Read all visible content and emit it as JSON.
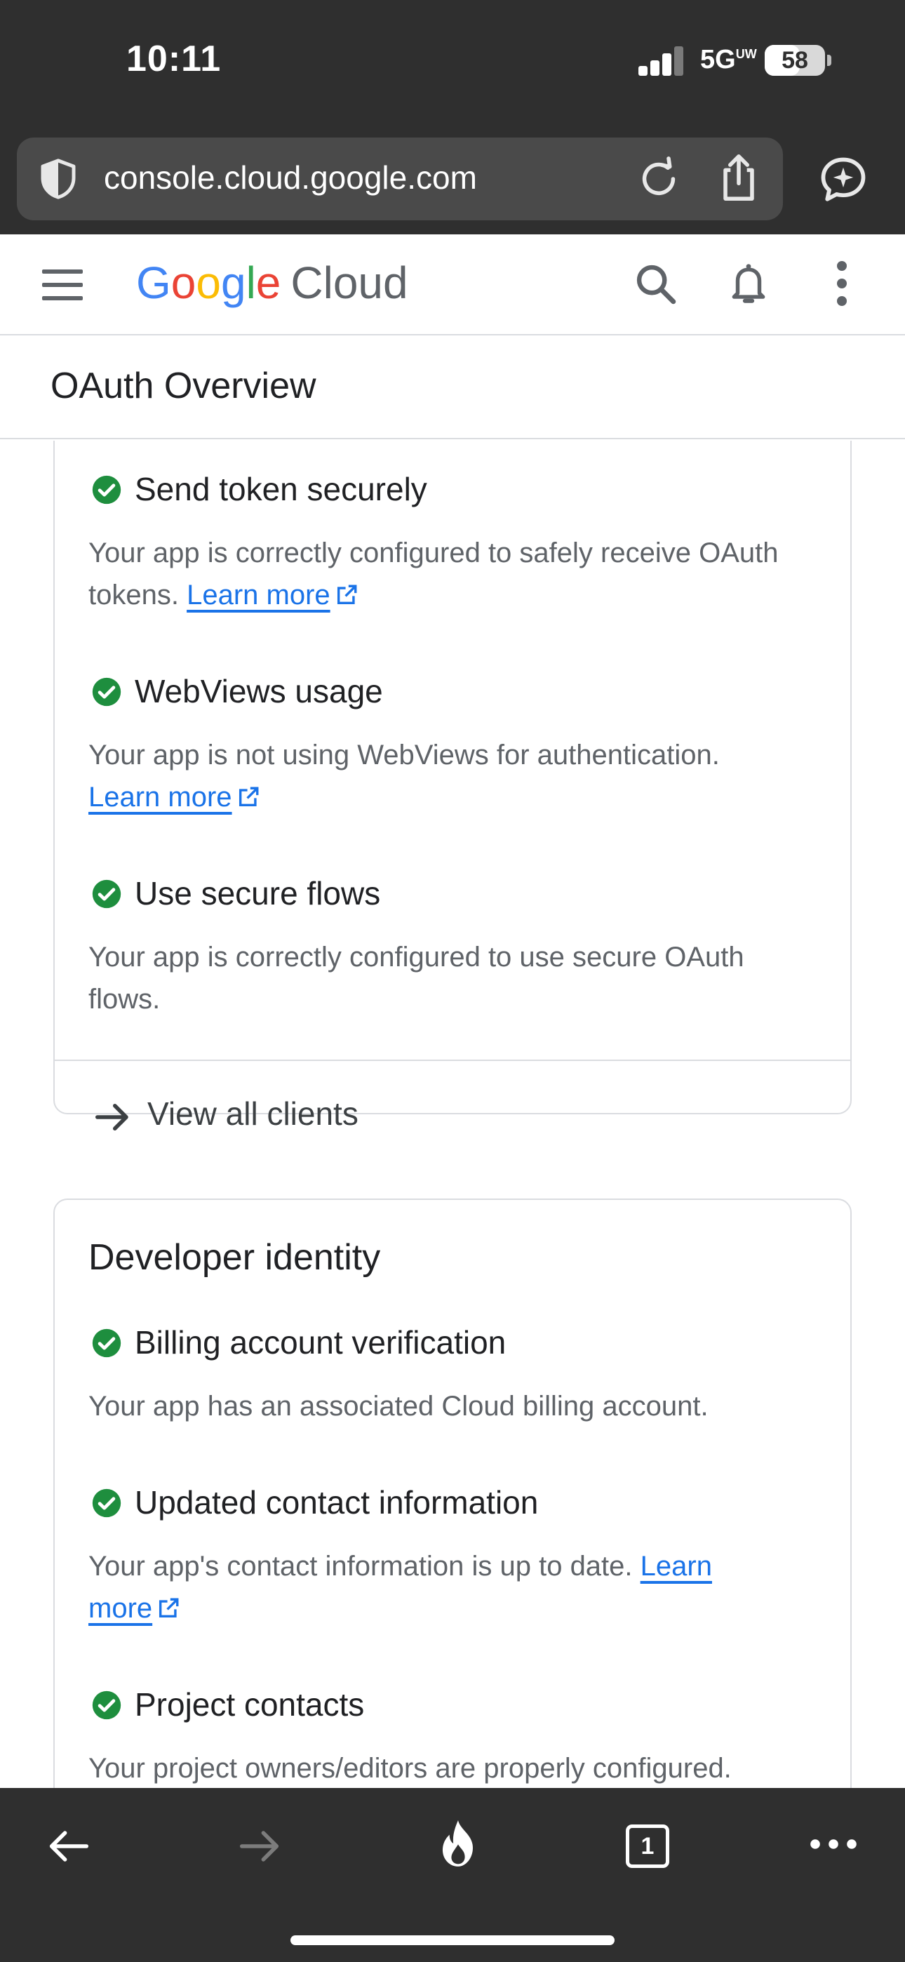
{
  "status_bar": {
    "time": "10:11",
    "network": "5G",
    "network_badge": "UW",
    "battery": "58",
    "battery_level_percent": 58
  },
  "browser": {
    "url": "console.cloud.google.com",
    "icons": {
      "shield": "shield-icon",
      "reload": "reload-icon",
      "share": "share-icon",
      "assistant": "ai-assistant-icon"
    }
  },
  "header": {
    "logo_letters": [
      "G",
      "o",
      "o",
      "g",
      "l",
      "e"
    ],
    "logo_product": "Cloud",
    "icons": {
      "menu": "hamburger-menu-icon",
      "search": "search-icon",
      "notifications": "bell-icon",
      "more": "more-vert-icon"
    }
  },
  "page": {
    "title": "OAuth Overview"
  },
  "client_checks": {
    "items": [
      {
        "title": "Send token securely",
        "desc_line1": "Your app is correctly configured to safely receive OAuth",
        "desc_line2_prefix": "tokens.",
        "link": "Learn more"
      },
      {
        "title": "WebViews usage",
        "desc_line1": "Your app is not using WebViews for authentication.",
        "link": "Learn more"
      },
      {
        "title": "Use secure flows",
        "desc_line1": "Your app is correctly configured to use secure OAuth",
        "desc_line2": "flows."
      }
    ],
    "view_all": "View all clients"
  },
  "developer_identity": {
    "title": "Developer identity",
    "items": [
      {
        "title": "Billing account verification",
        "desc": "Your app has an associated Cloud billing account."
      },
      {
        "title": "Updated contact information",
        "desc_prefix": "Your app's contact information is up to date.",
        "link_part1": "Learn",
        "link_part2": "more"
      },
      {
        "title": "Project contacts",
        "desc": "Your project owners/editors are properly configured."
      }
    ]
  },
  "colors": {
    "check_green": "#1e8e3e",
    "link_blue": "#1a73e8",
    "chrome_dark": "#2f2f2f"
  },
  "bottom_toolbar": {
    "tab_count": "1",
    "icons": {
      "back": "back-arrow-icon",
      "forward": "forward-arrow-icon",
      "fire": "fire-icon",
      "tabs": "tabs-icon",
      "more": "more-horiz-icon"
    }
  }
}
